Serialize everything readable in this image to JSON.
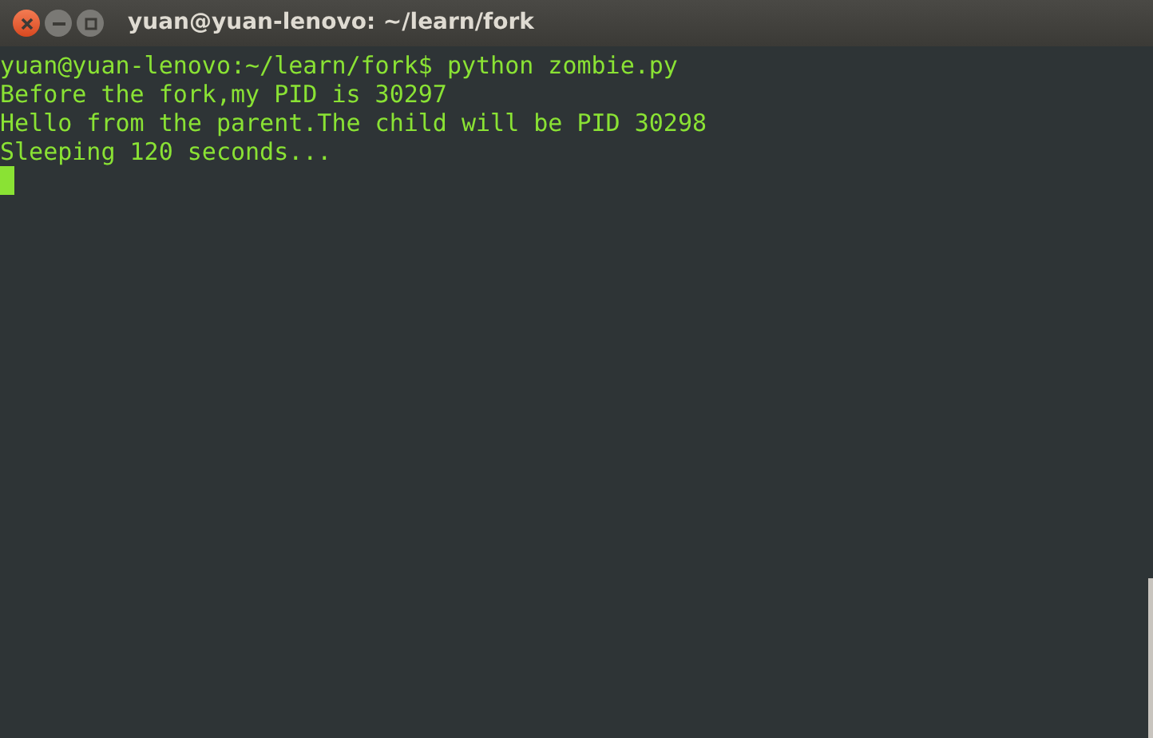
{
  "window": {
    "title": "yuan@yuan-lenovo: ~/learn/fork"
  },
  "terminal": {
    "lines": [
      "yuan@yuan-lenovo:~/learn/fork$ python zombie.py",
      "Before the fork,my PID is 30297",
      "Hello from the parent.The child will be PID 30298",
      "Sleeping 120 seconds..."
    ]
  }
}
